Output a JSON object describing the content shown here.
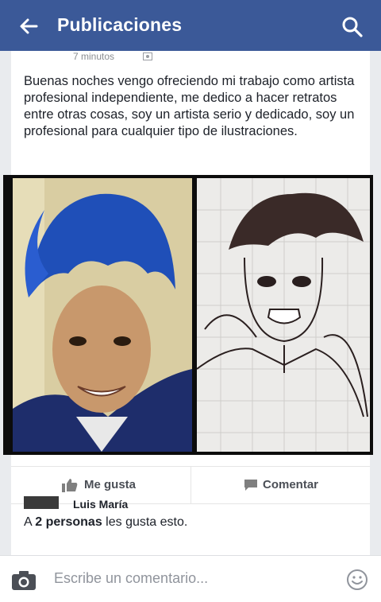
{
  "header": {
    "title": "Publicaciones",
    "back_icon": "back-arrow-icon",
    "search_icon": "search-icon",
    "bg": "#3b5998"
  },
  "post": {
    "time": "7 minutos",
    "text": "Buenas noches vengo ofreciendo mi trabajo como artista profesional independiente, me dedico a hacer retratos entre otras cosas, soy un artista serio y dedicado, soy un profesional para cualquier tipo de ilustraciones."
  },
  "actions": {
    "like_label": "Me gusta",
    "comment_label": "Comentar"
  },
  "likes": {
    "prefix": "A ",
    "count": "2 personas",
    "suffix": " les gusta esto."
  },
  "next_comment": {
    "name": "Luis María"
  },
  "composer": {
    "placeholder": "Escribe un comentario..."
  }
}
